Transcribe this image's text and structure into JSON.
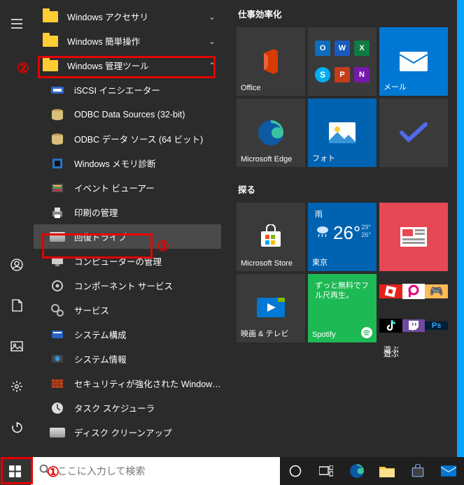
{
  "app_list": {
    "items": [
      {
        "label": "Windows アクセサリ",
        "icon": "folder",
        "chev": "down",
        "sub": false
      },
      {
        "label": "Windows 簡単操作",
        "icon": "folder",
        "chev": "down",
        "sub": false
      },
      {
        "label": "Windows 管理ツール",
        "icon": "folder",
        "chev": "up",
        "sub": false,
        "highlight": true
      },
      {
        "label": "iSCSI イニシエーター",
        "icon": "iscsi",
        "sub": true
      },
      {
        "label": "ODBC Data Sources (32-bit)",
        "icon": "odbc",
        "sub": true
      },
      {
        "label": "ODBC データ ソース (64 ビット)",
        "icon": "odbc",
        "sub": true
      },
      {
        "label": "Windows メモリ診断",
        "icon": "memory",
        "sub": true
      },
      {
        "label": "イベント ビューアー",
        "icon": "eventvwr",
        "sub": true
      },
      {
        "label": "印刷の管理",
        "icon": "print",
        "sub": true
      },
      {
        "label": "回復ドライブ",
        "icon": "drive",
        "sub": true,
        "hover": true
      },
      {
        "label": "コンピューターの管理",
        "icon": "compmgmt",
        "sub": true
      },
      {
        "label": "コンポーネント サービス",
        "icon": "component",
        "sub": true
      },
      {
        "label": "サービス",
        "icon": "services",
        "sub": true
      },
      {
        "label": "システム構成",
        "icon": "msconfig",
        "sub": true
      },
      {
        "label": "システム情報",
        "icon": "sysinfo",
        "sub": true
      },
      {
        "label": "セキュリティが強化された Windows Def...",
        "icon": "firewall",
        "sub": true
      },
      {
        "label": "タスク スケジューラ",
        "icon": "tasksched",
        "sub": true
      },
      {
        "label": "ディスク クリーンアップ",
        "icon": "diskclean",
        "sub": true
      }
    ]
  },
  "tile_groups": {
    "group1": {
      "title": "仕事効率化",
      "tiles": {
        "office": {
          "label": "Office"
        },
        "m365": {
          "label": ""
        },
        "mail": {
          "label": "メール"
        },
        "edge": {
          "label": "Microsoft Edge"
        },
        "photos": {
          "label": "フォト"
        },
        "todo": {
          "label": ""
        }
      }
    },
    "group2": {
      "title": "探る",
      "tiles": {
        "store": {
          "label": "Microsoft Store"
        },
        "weather": {
          "label": "東京",
          "city": "雨",
          "temp": "26°",
          "hi": "29°",
          "lo": "26°"
        },
        "news": {
          "label": ""
        },
        "movies": {
          "label": "映画 & テレビ"
        },
        "spotify": {
          "label": "Spotify",
          "text": "ずっと無料でフル尺再生。"
        },
        "play": {
          "label": "遊ぶ"
        }
      }
    }
  },
  "taskbar": {
    "search_placeholder": "ここに入力して検索"
  },
  "annotations": {
    "a1": "①",
    "a2": "②",
    "a3": "③"
  }
}
